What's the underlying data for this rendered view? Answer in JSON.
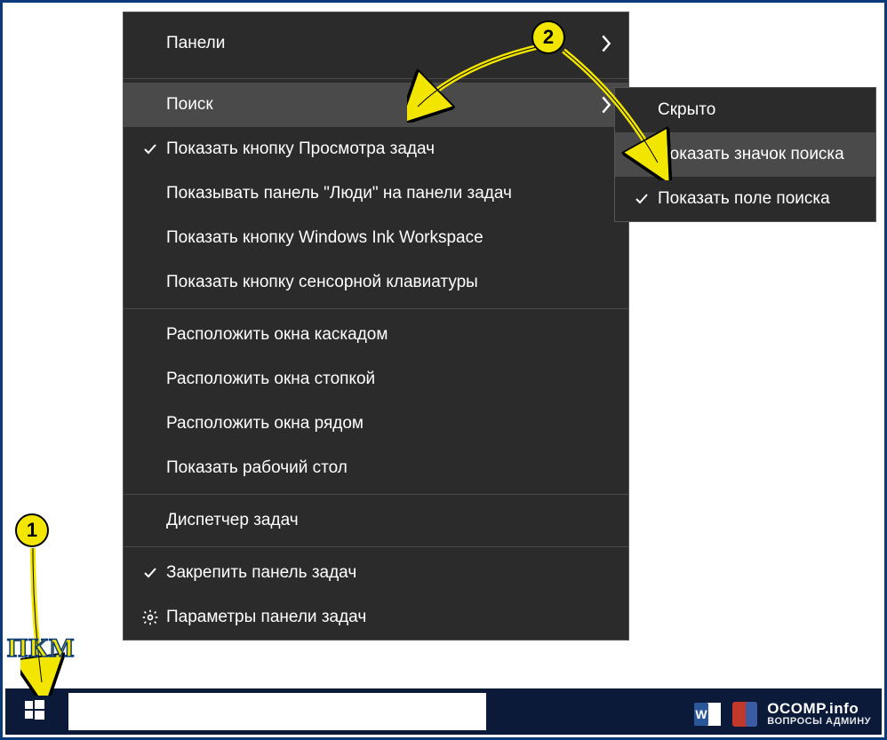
{
  "menu": {
    "panels": "Панели",
    "search": "Поиск",
    "task_view": "Показать кнопку Просмотра задач",
    "people": "Показывать панель \"Люди\" на панели задач",
    "ink": "Показать кнопку Windows Ink Workspace",
    "touch_kbd": "Показать кнопку сенсорной клавиатуры",
    "cascade": "Расположить окна каскадом",
    "stacked": "Расположить окна стопкой",
    "sidebyside": "Расположить окна рядом",
    "show_desktop": "Показать рабочий стол",
    "task_mgr": "Диспетчер задач",
    "lock_taskbar": "Закрепить панель задач",
    "settings": "Параметры панели задач"
  },
  "submenu": {
    "hidden": "Скрыто",
    "show_icon": "Показать значок поиска",
    "show_box": "Показать поле поиска"
  },
  "annotations": {
    "badge1": "1",
    "badge2": "2",
    "pkm": "ПКМ"
  },
  "watermark": {
    "line1": "OCOMP.info",
    "line2": "ВОПРОСЫ АДМИНУ"
  }
}
